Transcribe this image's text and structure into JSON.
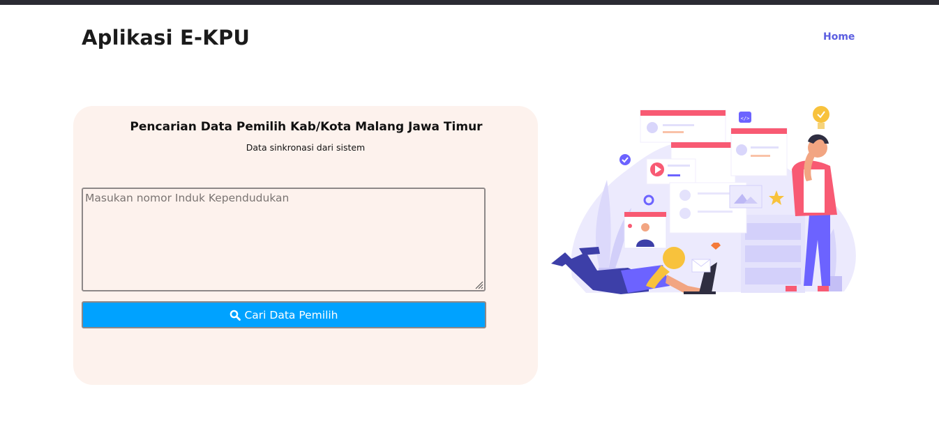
{
  "header": {
    "brand": "Aplikasi E-KPU",
    "nav_home": "Home"
  },
  "search_card": {
    "title": "Pencarian Data Pemilih Kab/Kota Malang Jawa Timur",
    "subtitle": "Data sinkronasi dari sistem",
    "nik_placeholder": "Masukan nomor Induk Kependudukan",
    "nik_value": "",
    "button_label": "Cari Data Pemilih",
    "button_icon": "search-icon"
  },
  "colors": {
    "brand_text": "#1b1b1b",
    "nav_link": "#5b5ee0",
    "card_bg": "#fdf2ed",
    "button_bg": "#00a2ff",
    "illustration_accent": "#f85a73",
    "illustration_primary": "#6c63ff"
  }
}
